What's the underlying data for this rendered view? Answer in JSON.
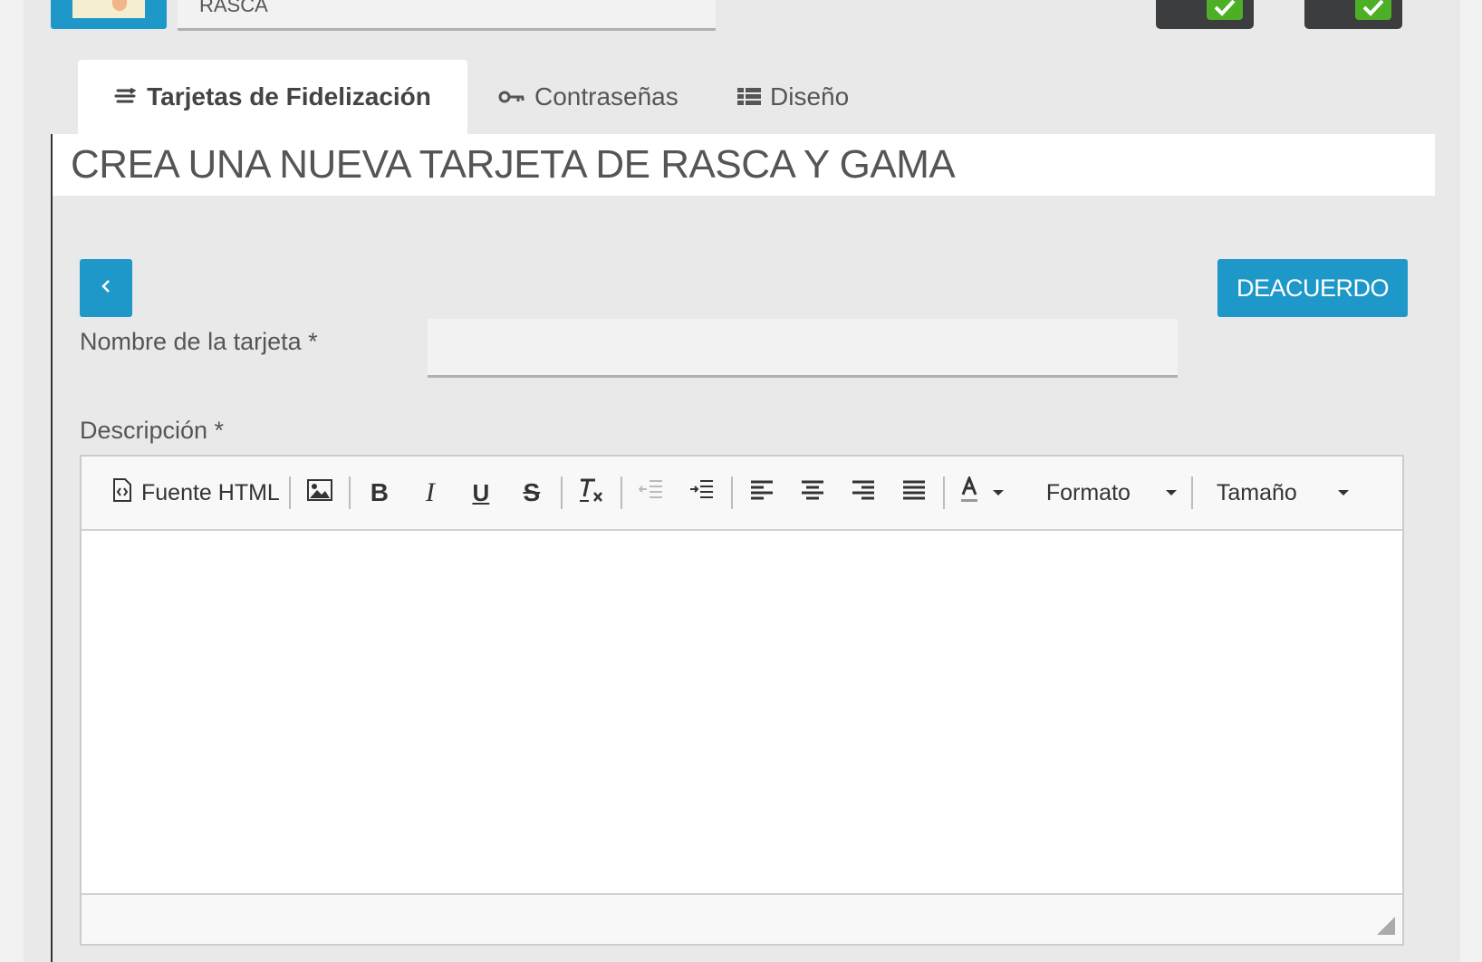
{
  "top": {
    "card_name_value": "RASCA"
  },
  "tabs": [
    {
      "label": "Tarjetas de Fidelización",
      "icon": "loyalty-card-icon",
      "active": true
    },
    {
      "label": "Contraseñas",
      "icon": "key-icon",
      "active": false
    },
    {
      "label": "Diseño",
      "icon": "grid-icon",
      "active": false
    }
  ],
  "page_title": "CREA UNA NUEVA TARJETA DE RASCA Y GAMA",
  "buttons": {
    "back_icon": "chevron-left-icon",
    "ok_label": "DEACUERDO"
  },
  "form": {
    "name_label": "Nombre de la tarjeta *",
    "name_value": "",
    "description_label": "Descripción *"
  },
  "editor": {
    "source_label": "Fuente HTML",
    "format_label": "Formato",
    "size_label": "Tamaño"
  },
  "colors": {
    "accent": "#1e98c9",
    "check_green": "#4caf26",
    "toggle_dark": "#3c3d3f"
  }
}
